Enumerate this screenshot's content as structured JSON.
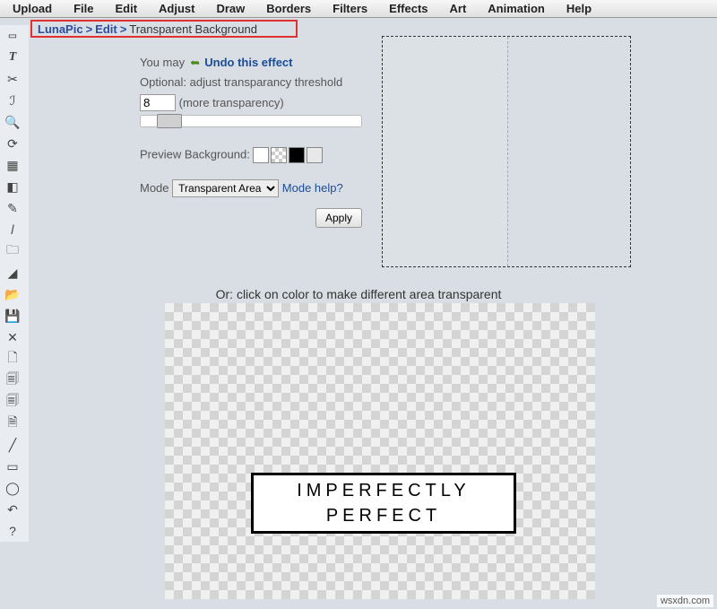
{
  "menu": [
    "Upload",
    "File",
    "Edit",
    "Adjust",
    "Draw",
    "Borders",
    "Filters",
    "Effects",
    "Art",
    "Animation",
    "Help"
  ],
  "breadcrumb": {
    "root": "LunaPic",
    "section": "Edit",
    "page": "Transparent Background"
  },
  "controls": {
    "youmay": "You may",
    "undo": "Undo this effect",
    "optional_label": "Optional: adjust transparancy threshold",
    "threshold_value": "8",
    "more_transp": "(more transparency)",
    "preview_bg_label": "Preview Background:",
    "mode_label": "Mode",
    "mode_value": "Transparent Area",
    "mode_help": "Mode help?",
    "apply": "Apply"
  },
  "sub_header": "Or: click on color to make different area transparent",
  "stamp": {
    "line1": "IMPERFECTLY",
    "line2": "PERFECT"
  },
  "watermark": "wsxdn.com",
  "tools": [
    "select",
    "text",
    "cut",
    "brush",
    "zoom",
    "rotate",
    "gradient",
    "fill",
    "eyedrop",
    "pencil",
    "folder",
    "eraser",
    "open",
    "save",
    "close",
    "page",
    "layers",
    "pages",
    "copy",
    "line",
    "rect",
    "circle",
    "undo2",
    "help"
  ]
}
